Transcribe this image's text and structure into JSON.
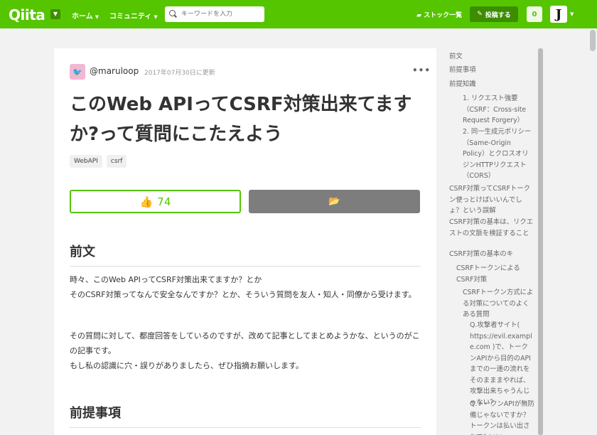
{
  "header": {
    "logo": "Qiita",
    "nav": [
      {
        "label": "ホーム"
      },
      {
        "label": "コミュニティ"
      }
    ],
    "search_placeholder": "キーワードを入力",
    "stock_label": "ストック一覧",
    "post_label": "投稿する",
    "notification_count": "0",
    "user_avatar_letter": "J"
  },
  "article": {
    "author": "@maruloop",
    "updated": "2017年07月30日に更新",
    "title": "このWeb APIってCSRF対策出来てますか?って質問にこたえよう",
    "tags": [
      "WebAPI",
      "csrf"
    ],
    "like_count": "74",
    "section1_heading": "前文",
    "section1_p1": "時々、このWeb APIってCSRF対策出来てますか？とか\nそのCSRF対策ってなんで安全なんですか？とか、そういう質問を友人・知人・同僚から受けます。",
    "section1_p2": "その質問に対して、都度回答をしているのですが、改めて記事としてまとめようかな、というのがこの記事です。\nもし私の認識に穴・誤りがありましたら、ぜひ指摘お願いします。",
    "section2_heading": "前提事項"
  },
  "toc": [
    {
      "label": "前文"
    },
    {
      "label": "前提事項"
    },
    {
      "label": "前提知識"
    },
    {
      "label": "1. リクエスト強要\n（CSRF：Cross-site\nRequest Forgery）"
    },
    {
      "label": "2. 同一生成元ポリシー（Same-Origin\nPolicy）とクロスオリジンHTTPリクエスト（CORS）"
    },
    {
      "label": "CSRF対策ってCSRFトークン使っとけばいいんでしょ？という誤解"
    },
    {
      "label": "CSRF対策の基本は、リクエストの文脈を検証すること"
    },
    {
      "label": "CSRF対策の基本のキ"
    },
    {
      "label": "CSRFトークンによるCSRF対策"
    },
    {
      "label": "CSRFトークン方式による対策についてのよくある質問"
    },
    {
      "label": "Q.攻撃者サイト( https://evil.exampl\ne.com )で、トークンAPIから目的のAPIまでの一連の流れをそのまままやれば、攻撃出来ちゃうんじゃない？"
    },
    {
      "label": "Q.トークンAPIが無防備じゃないですか？トークンは払い出されてもいい"
    }
  ],
  "colors": {
    "brand": "#55c500",
    "brand_dark": "#3c8d00",
    "stock_button": "#7d7d7d"
  },
  "icons": {
    "logo_dropdown": "chevron-down-icon",
    "search": "search-icon",
    "stock_list": "folder-icon",
    "post": "pencil-icon",
    "like": "thumbs-up-icon",
    "stock": "folder-open-icon",
    "more": "ellipsis-icon"
  }
}
